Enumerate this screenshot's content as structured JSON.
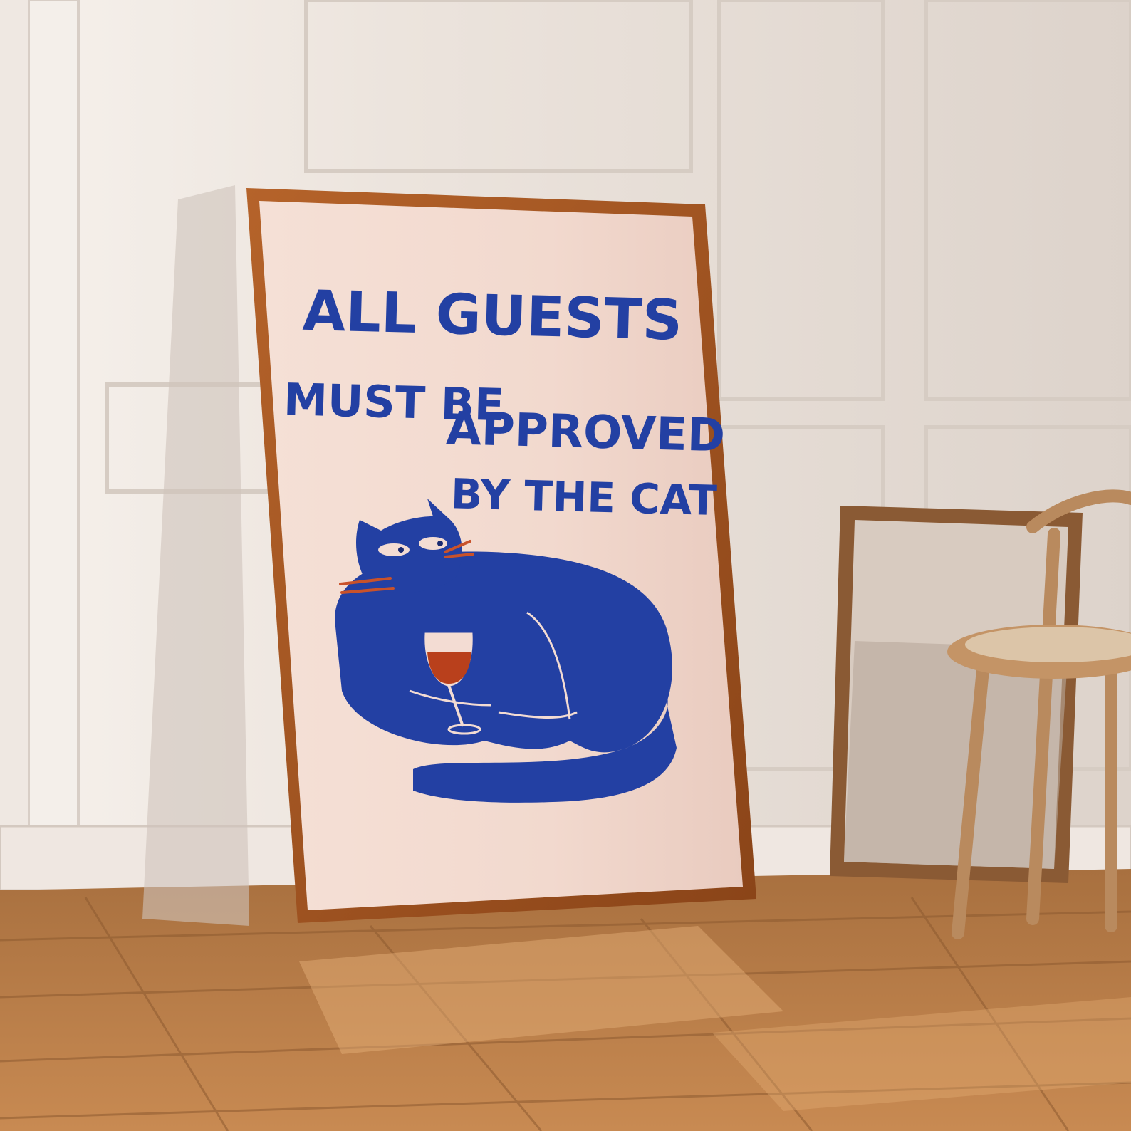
{
  "scene": {
    "description_colors": {
      "wall": "#ebe4de",
      "floor": "#b87a45",
      "frame_wood": "#a5561e",
      "poster_bg": "#f3dcd3",
      "cat_blue": "#2340a3",
      "wine_red": "#b9401c",
      "whisker_orange": "#c9522a"
    }
  },
  "poster": {
    "line1": "ALL GUESTS",
    "line2": "MUST BE",
    "line3": "APPROVED",
    "line4": "BY THE CAT"
  }
}
